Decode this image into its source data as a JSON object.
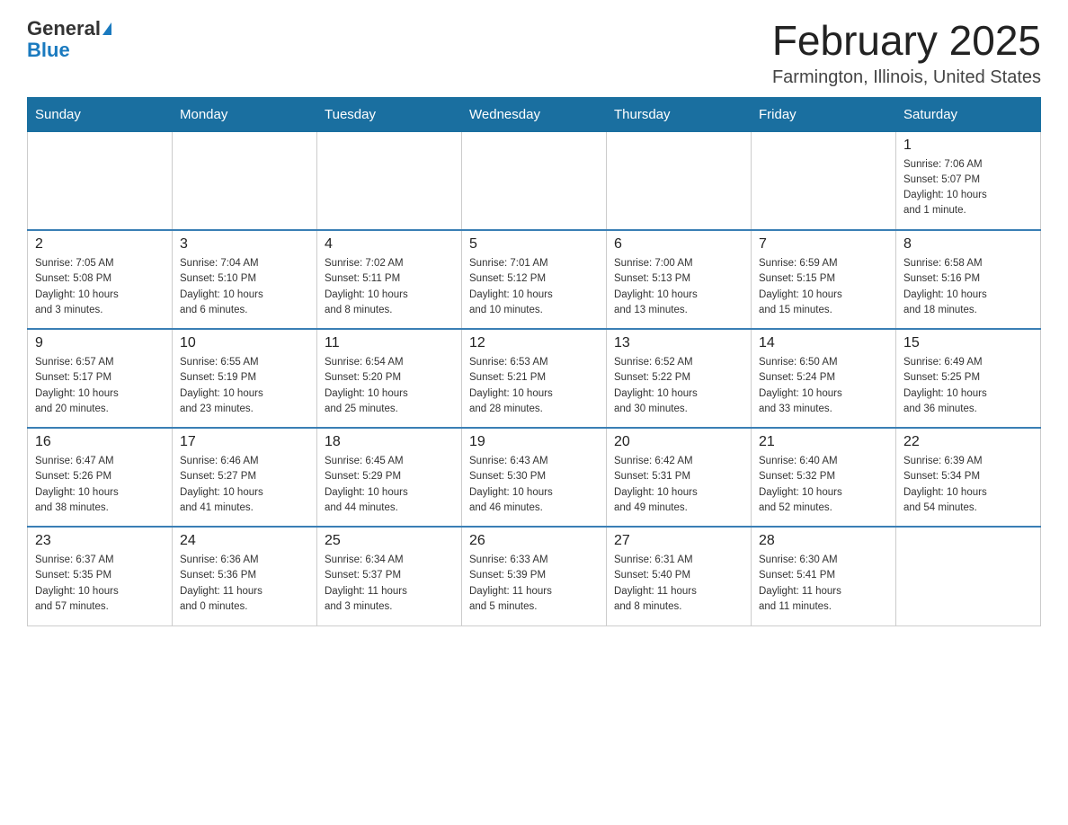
{
  "header": {
    "logo_general": "General",
    "logo_blue": "Blue",
    "month_title": "February 2025",
    "location": "Farmington, Illinois, United States"
  },
  "days_of_week": [
    "Sunday",
    "Monday",
    "Tuesday",
    "Wednesday",
    "Thursday",
    "Friday",
    "Saturday"
  ],
  "weeks": [
    [
      {
        "day": "",
        "info": ""
      },
      {
        "day": "",
        "info": ""
      },
      {
        "day": "",
        "info": ""
      },
      {
        "day": "",
        "info": ""
      },
      {
        "day": "",
        "info": ""
      },
      {
        "day": "",
        "info": ""
      },
      {
        "day": "1",
        "info": "Sunrise: 7:06 AM\nSunset: 5:07 PM\nDaylight: 10 hours\nand 1 minute."
      }
    ],
    [
      {
        "day": "2",
        "info": "Sunrise: 7:05 AM\nSunset: 5:08 PM\nDaylight: 10 hours\nand 3 minutes."
      },
      {
        "day": "3",
        "info": "Sunrise: 7:04 AM\nSunset: 5:10 PM\nDaylight: 10 hours\nand 6 minutes."
      },
      {
        "day": "4",
        "info": "Sunrise: 7:02 AM\nSunset: 5:11 PM\nDaylight: 10 hours\nand 8 minutes."
      },
      {
        "day": "5",
        "info": "Sunrise: 7:01 AM\nSunset: 5:12 PM\nDaylight: 10 hours\nand 10 minutes."
      },
      {
        "day": "6",
        "info": "Sunrise: 7:00 AM\nSunset: 5:13 PM\nDaylight: 10 hours\nand 13 minutes."
      },
      {
        "day": "7",
        "info": "Sunrise: 6:59 AM\nSunset: 5:15 PM\nDaylight: 10 hours\nand 15 minutes."
      },
      {
        "day": "8",
        "info": "Sunrise: 6:58 AM\nSunset: 5:16 PM\nDaylight: 10 hours\nand 18 minutes."
      }
    ],
    [
      {
        "day": "9",
        "info": "Sunrise: 6:57 AM\nSunset: 5:17 PM\nDaylight: 10 hours\nand 20 minutes."
      },
      {
        "day": "10",
        "info": "Sunrise: 6:55 AM\nSunset: 5:19 PM\nDaylight: 10 hours\nand 23 minutes."
      },
      {
        "day": "11",
        "info": "Sunrise: 6:54 AM\nSunset: 5:20 PM\nDaylight: 10 hours\nand 25 minutes."
      },
      {
        "day": "12",
        "info": "Sunrise: 6:53 AM\nSunset: 5:21 PM\nDaylight: 10 hours\nand 28 minutes."
      },
      {
        "day": "13",
        "info": "Sunrise: 6:52 AM\nSunset: 5:22 PM\nDaylight: 10 hours\nand 30 minutes."
      },
      {
        "day": "14",
        "info": "Sunrise: 6:50 AM\nSunset: 5:24 PM\nDaylight: 10 hours\nand 33 minutes."
      },
      {
        "day": "15",
        "info": "Sunrise: 6:49 AM\nSunset: 5:25 PM\nDaylight: 10 hours\nand 36 minutes."
      }
    ],
    [
      {
        "day": "16",
        "info": "Sunrise: 6:47 AM\nSunset: 5:26 PM\nDaylight: 10 hours\nand 38 minutes."
      },
      {
        "day": "17",
        "info": "Sunrise: 6:46 AM\nSunset: 5:27 PM\nDaylight: 10 hours\nand 41 minutes."
      },
      {
        "day": "18",
        "info": "Sunrise: 6:45 AM\nSunset: 5:29 PM\nDaylight: 10 hours\nand 44 minutes."
      },
      {
        "day": "19",
        "info": "Sunrise: 6:43 AM\nSunset: 5:30 PM\nDaylight: 10 hours\nand 46 minutes."
      },
      {
        "day": "20",
        "info": "Sunrise: 6:42 AM\nSunset: 5:31 PM\nDaylight: 10 hours\nand 49 minutes."
      },
      {
        "day": "21",
        "info": "Sunrise: 6:40 AM\nSunset: 5:32 PM\nDaylight: 10 hours\nand 52 minutes."
      },
      {
        "day": "22",
        "info": "Sunrise: 6:39 AM\nSunset: 5:34 PM\nDaylight: 10 hours\nand 54 minutes."
      }
    ],
    [
      {
        "day": "23",
        "info": "Sunrise: 6:37 AM\nSunset: 5:35 PM\nDaylight: 10 hours\nand 57 minutes."
      },
      {
        "day": "24",
        "info": "Sunrise: 6:36 AM\nSunset: 5:36 PM\nDaylight: 11 hours\nand 0 minutes."
      },
      {
        "day": "25",
        "info": "Sunrise: 6:34 AM\nSunset: 5:37 PM\nDaylight: 11 hours\nand 3 minutes."
      },
      {
        "day": "26",
        "info": "Sunrise: 6:33 AM\nSunset: 5:39 PM\nDaylight: 11 hours\nand 5 minutes."
      },
      {
        "day": "27",
        "info": "Sunrise: 6:31 AM\nSunset: 5:40 PM\nDaylight: 11 hours\nand 8 minutes."
      },
      {
        "day": "28",
        "info": "Sunrise: 6:30 AM\nSunset: 5:41 PM\nDaylight: 11 hours\nand 11 minutes."
      },
      {
        "day": "",
        "info": ""
      }
    ]
  ]
}
